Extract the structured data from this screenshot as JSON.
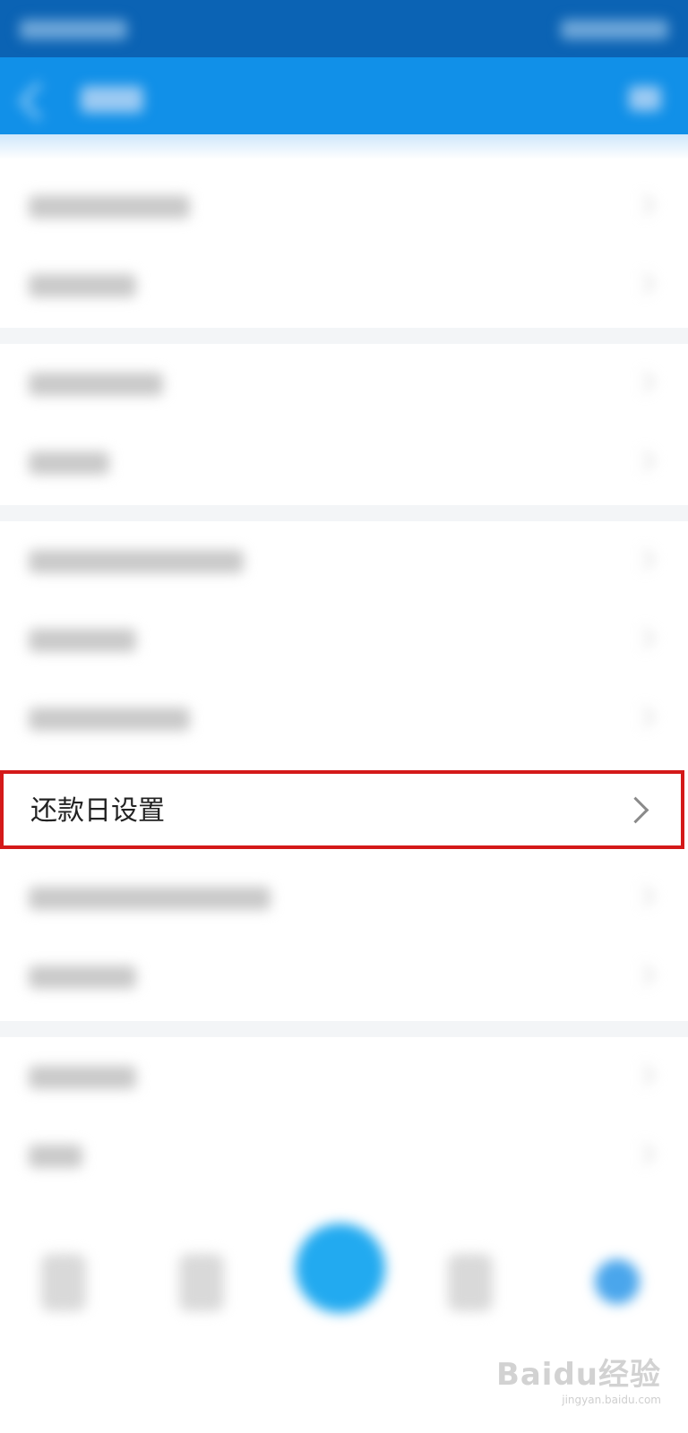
{
  "highlighted_item": {
    "label": "还款日设置"
  },
  "watermark": {
    "brand": "Baidu经验",
    "site": "jingyan.baidu.com"
  },
  "colors": {
    "status_bar": "#0b63b4",
    "app_bar": "#1190e8",
    "highlight_border": "#d41919",
    "fab": "#22aaf0"
  },
  "icons": {
    "back": "back-arrow-icon",
    "chevron": "chevron-right-icon"
  }
}
